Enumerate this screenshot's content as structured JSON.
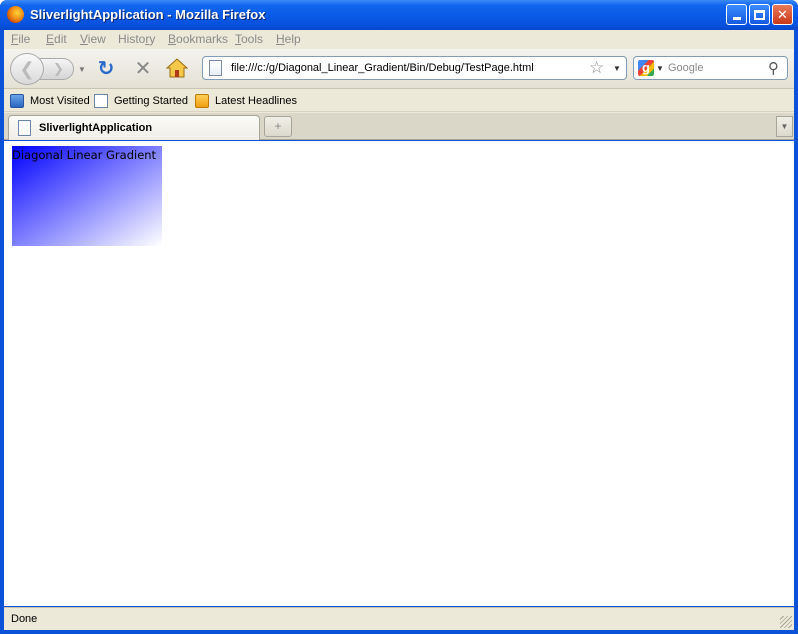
{
  "window": {
    "title": "SliverlightApplication - Mozilla Firefox"
  },
  "menu": {
    "items": [
      {
        "key": "F",
        "rest": "ile"
      },
      {
        "key": "E",
        "rest": "dit"
      },
      {
        "key": "V",
        "rest": "iew"
      },
      {
        "key": "",
        "rest": "History",
        "underline_index": 5
      },
      {
        "key": "B",
        "rest": "ookmarks"
      },
      {
        "key": "T",
        "rest": "ools"
      },
      {
        "key": "H",
        "rest": "elp"
      }
    ]
  },
  "navigation": {
    "url": "file:///c:/g/Diagonal_Linear_Gradient/Bin/Debug/TestPage.html",
    "search_placeholder": "Google"
  },
  "bookmarks": {
    "items": [
      {
        "label": "Most Visited"
      },
      {
        "label": "Getting Started"
      },
      {
        "label": "Latest Headlines"
      }
    ]
  },
  "tabs": {
    "active": {
      "label": "SliverlightApplication"
    },
    "new_tab_symbol": "+"
  },
  "content": {
    "gradient_text": "Diagonal Linear Gradient",
    "gradient_start_color": "#0000ff",
    "gradient_end_color": "#ffffff"
  },
  "status": {
    "text": "Done"
  },
  "colors": {
    "titlebar": "#0a5ce8",
    "chrome": "#ece9d8"
  }
}
